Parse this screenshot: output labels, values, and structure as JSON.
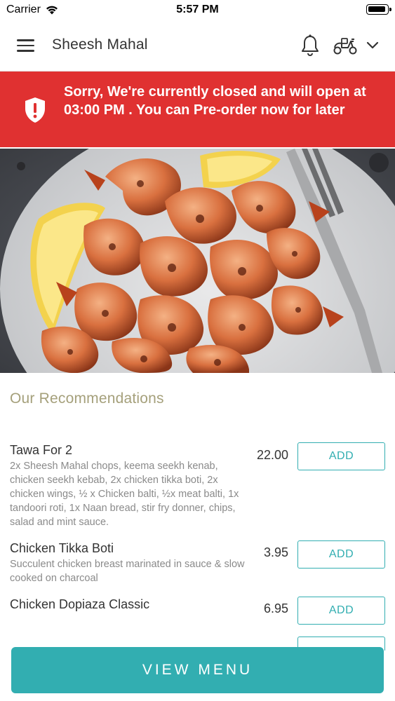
{
  "status_bar": {
    "carrier": "Carrier",
    "time": "5:57 PM"
  },
  "header": {
    "title": "Sheesh Mahal",
    "icons": [
      "menu-icon",
      "bell-icon",
      "scooter-icon",
      "chevron-down-icon"
    ]
  },
  "banner": {
    "text": "Sorry, We're currently closed and will open at 03:00 PM . You can Pre-order now for later",
    "background_color": "#e03131",
    "icon": "shield-alert-icon"
  },
  "hero": {
    "image": "grilled prawns on a plate with lemon wedges and a fork"
  },
  "recommendations": {
    "title": "Our Recommendations",
    "items": [
      {
        "name": "Tawa For 2",
        "description": "2x Sheesh Mahal chops, keema seekh kenab, chicken seekh kebab, 2x chicken tikka boti, 2x chicken wings, ½ x Chicken balti, ½x  meat balti, 1x tandoori roti, 1x Naan bread, stir fry donner, chips, salad and mint sauce.",
        "price": "22.00",
        "add_label": "ADD"
      },
      {
        "name": "Chicken Tikka Boti",
        "description": "Succulent chicken breast marinated in sauce & slow cooked on charcoal",
        "price": "3.95",
        "add_label": "ADD"
      },
      {
        "name": "Chicken Dopiaza Classic",
        "description": "",
        "price": "6.95",
        "add_label": "ADD"
      }
    ]
  },
  "footer": {
    "view_menu_label": "VIEW MENU"
  },
  "colors": {
    "accent": "#32aeb1",
    "section_title": "#a5a07b",
    "alert": "#e03131"
  }
}
